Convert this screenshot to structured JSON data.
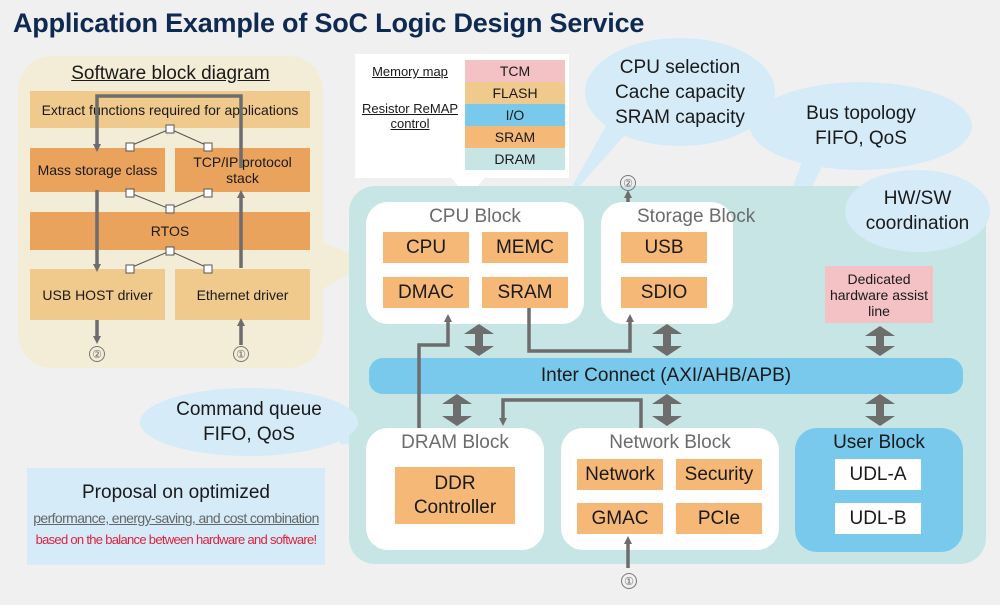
{
  "title": "Application Example of SoC Logic Design Service",
  "software": {
    "heading": "Software block diagram",
    "extract": "Extract functions required for applications",
    "mass_storage": "Mass storage class",
    "tcpip": "TCP/IP protocol stack",
    "rtos": "RTOS",
    "usb_host": "USB HOST driver",
    "ethernet": "Ethernet driver",
    "marker_out": "②",
    "marker_in": "①"
  },
  "memory_map": {
    "label": "Memory map",
    "remap_label": "Resistor ReMAP control",
    "regions": [
      {
        "name": "TCM",
        "color": "#f4c1c4"
      },
      {
        "name": "FLASH",
        "color": "#f0c98c"
      },
      {
        "name": "I/O",
        "color": "#79c9ec"
      },
      {
        "name": "SRAM",
        "color": "#f5b877"
      },
      {
        "name": "DRAM",
        "color": "#c7e5e4"
      }
    ]
  },
  "callouts": {
    "cpu": "CPU selection Cache capacity SRAM capacity",
    "cpu_lines": [
      "CPU selection",
      "Cache capacity",
      "SRAM capacity"
    ],
    "bus_lines": [
      "Bus topology",
      "FIFO, QoS"
    ],
    "hwsw_lines": [
      "HW/SW",
      "coordination"
    ],
    "cmd_lines": [
      "Command queue",
      "FIFO, QoS"
    ]
  },
  "hardware": {
    "cpu_block": {
      "title": "CPU Block",
      "chips": [
        "CPU",
        "MEMC",
        "DMAC",
        "SRAM"
      ]
    },
    "storage_block": {
      "title": "Storage Block",
      "chips": [
        "USB",
        "SDIO"
      ],
      "marker": "②"
    },
    "dedicated": "Dedicated hardware assist line",
    "interconnect": "Inter Connect (AXI/AHB/APB)",
    "dram_block": {
      "title": "DRAM Block",
      "chip": "DDR Controller"
    },
    "network_block": {
      "title": "Network Block",
      "chips": [
        "Network",
        "Security",
        "GMAC",
        "PCIe"
      ],
      "marker": "①"
    },
    "user_block": {
      "title": "User Block",
      "chips": [
        "UDL-A",
        "UDL-B"
      ]
    }
  },
  "proposal": {
    "line1": "Proposal on optimized",
    "line2": "performance, energy-saving, and cost combination",
    "line3": "based on the balance between hardware and software!"
  },
  "colors": {
    "title": "#0e2a52",
    "accent_red": "#e0213b",
    "chip": "#f5b877",
    "bus": "#79c9ec",
    "panel": "#c7e5e4"
  }
}
